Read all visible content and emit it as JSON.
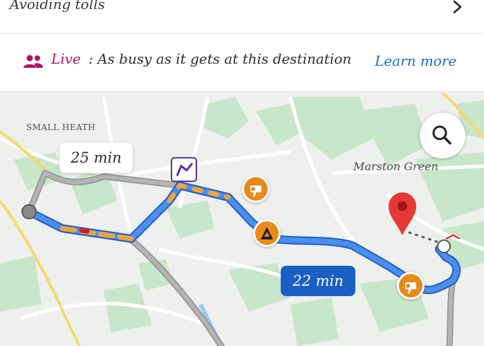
{
  "route_option": {
    "label": "Avoiding tolls",
    "icon": "chevron-right-icon"
  },
  "live": {
    "label": "Live",
    "message": ": As busy as it gets at this destination",
    "link": "Learn more",
    "accent_color": "#b0106e",
    "link_color": "#1a6bd0"
  },
  "map": {
    "places": [
      "SMALL HEATH",
      "Marston Green"
    ],
    "alt_route_time": "25 min",
    "main_route_time": "22 min",
    "route_color": "#4a8ef0",
    "badges": [
      "speed-camera-icon",
      "roadworks-icon",
      "speed-camera-icon"
    ]
  }
}
